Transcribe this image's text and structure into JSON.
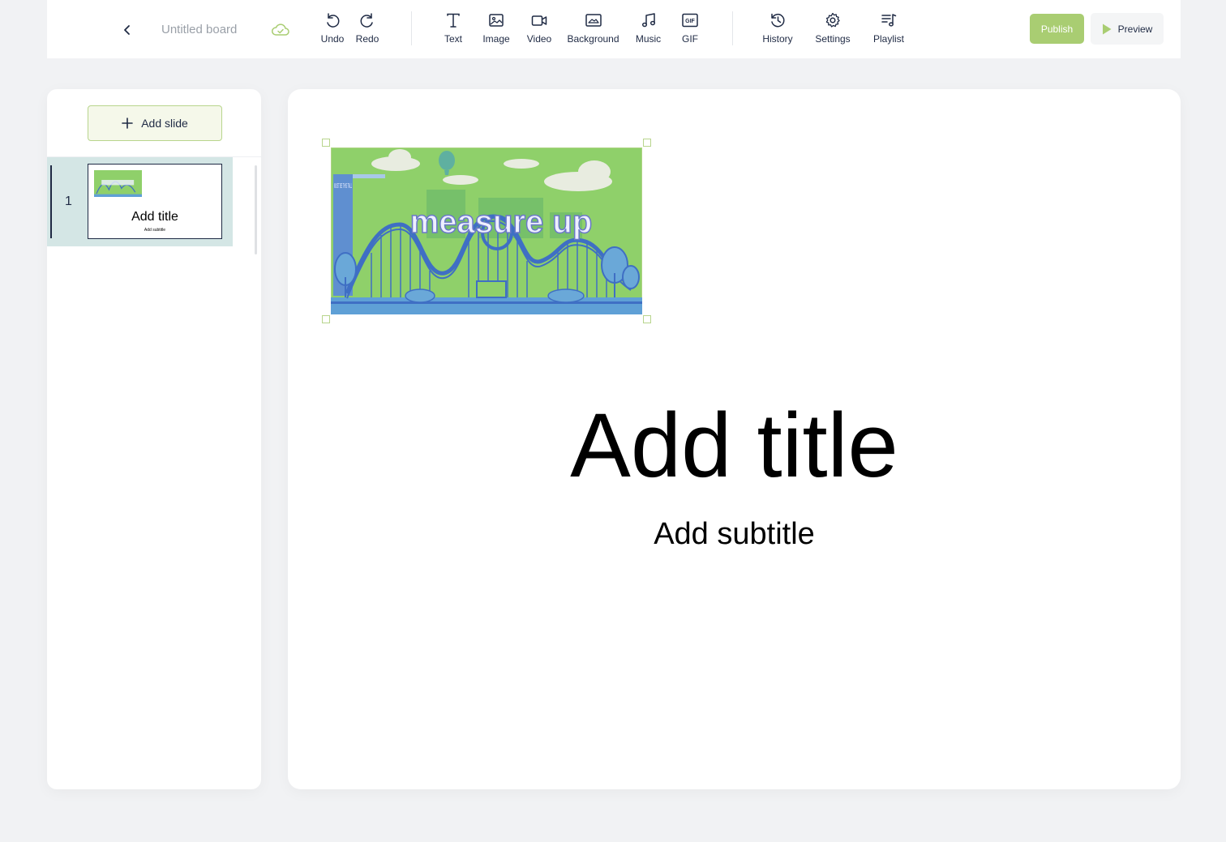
{
  "header": {
    "board_title": "Untitled board",
    "icons": {
      "back": "chevron-left-icon",
      "saved": "cloud-check-icon"
    }
  },
  "toolbar": {
    "undo": "Undo",
    "redo": "Redo",
    "text": "Text",
    "image": "Image",
    "video": "Video",
    "background": "Background",
    "music": "Music",
    "gif": "GIF",
    "history": "History",
    "settings": "Settings",
    "playlist": "Playlist",
    "gif_glyph": "GIF"
  },
  "actions": {
    "publish": "Publish",
    "preview": "Preview"
  },
  "sidebar": {
    "add_slide": "Add slide",
    "slides": [
      {
        "number": "1",
        "title": "Add title",
        "subtitle": "Add subtitle"
      }
    ]
  },
  "canvas": {
    "image_text": "measure up",
    "sign_text": "MUST BE THIS TALL",
    "title": "Add title",
    "subtitle": "Add subtitle"
  },
  "colors": {
    "accent": "#a9cd72",
    "accent_border": "#b8d58d",
    "selected_slide": "#d4e6e5",
    "text_dark": "#1f2a44",
    "image_green": "#8fd06a",
    "image_blue": "#3f6fc4"
  }
}
